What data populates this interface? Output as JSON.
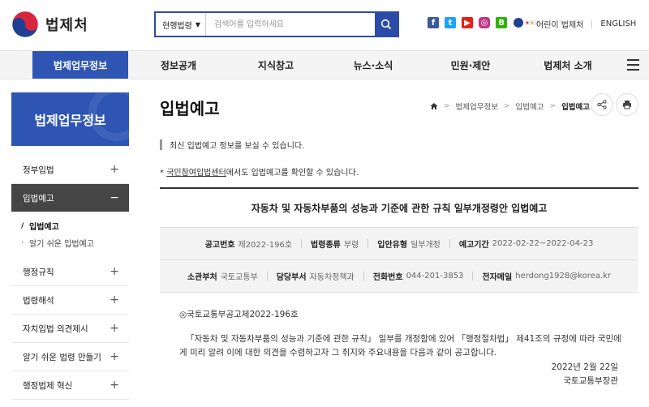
{
  "header": {
    "logo_text": "법제처",
    "search": {
      "scope": "현행법령",
      "placeholder": "검색어를 입력하세요"
    },
    "sns": [
      {
        "name": "facebook-icon",
        "glyph": "f",
        "color": "#3b5998"
      },
      {
        "name": "twitter-icon",
        "glyph": "t",
        "color": "#1da1f2"
      },
      {
        "name": "youtube-icon",
        "glyph": "▶",
        "color": "#e62117"
      },
      {
        "name": "instagram-icon",
        "glyph": "◎",
        "color": "#c13584"
      },
      {
        "name": "blog-icon",
        "glyph": "B",
        "color": "#2db400"
      }
    ],
    "links": [
      "어린이 법제처",
      "ENGLISH"
    ]
  },
  "gnb": {
    "items": [
      "법제업무정보",
      "정보공개",
      "지식창고",
      "뉴스·소식",
      "민원·제안",
      "법제처 소개"
    ]
  },
  "sidebar": {
    "title": "법제업무정보",
    "items": [
      {
        "label": "정부입법",
        "toggle": "+"
      },
      {
        "label": "입법예고",
        "toggle": "−"
      },
      {
        "label": "행정규칙",
        "toggle": "+"
      },
      {
        "label": "법령해석",
        "toggle": "+"
      },
      {
        "label": "자치입법 의견제시",
        "toggle": "+"
      },
      {
        "label": "알기 쉬운 법령 만들기",
        "toggle": "+"
      },
      {
        "label": "행정법제 혁신",
        "toggle": "+"
      }
    ],
    "sub_items": [
      {
        "label": "입법예고",
        "bullet": "/"
      },
      {
        "label": "알기 쉬운 입법예고",
        "bullet": "·"
      }
    ]
  },
  "content": {
    "title": "입법예고",
    "breadcrumb": [
      "법제업무정보",
      "입법예고",
      "입법예고"
    ],
    "intro": "최신 입법예고 정보를 보실 수 있습니다.",
    "notice_prefix": "* ",
    "notice_link": "국민참여입법센터",
    "notice_suffix": "에서도 입법예고를 확인할 수 있습니다.",
    "board": {
      "title": "자동차 및 자동차부품의 성능과 기준에 관한 규칙 일부개정령안 입법예고",
      "row1": [
        {
          "k": "공고번호",
          "v": "제2022-196호"
        },
        {
          "k": "법령종류",
          "v": "부령"
        },
        {
          "k": "입안유형",
          "v": "일부개정"
        },
        {
          "k": "예고기간",
          "v": "2022-02-22~2022-04-23"
        }
      ],
      "row2": [
        {
          "k": "소관부처",
          "v": "국토교통부"
        },
        {
          "k": "담당부서",
          "v": "자동차정책과"
        },
        {
          "k": "전화번호",
          "v": "044-201-3853"
        },
        {
          "k": "전자메일",
          "v": "herdong1928@korea.kr"
        }
      ]
    },
    "body": {
      "notice_no": "◎국토교통부공고제2022-196호",
      "paragraph": "「자동차 및 자동차부품의 성능과 기준에 관한 규칙」 일부를 개정함에 있어 「행정절차법」 제41조의 규정에 따라 국민에게 미리 알려 이에 대한 의견을 수렴하고자 그 취지와 주요내용을 다음과 같이 공고합니다.",
      "date": "2022년 2월 22일",
      "signer": "국토교통부장관"
    }
  },
  "colors": {
    "brand_blue": "#2e55b3",
    "search_blue": "#2b4ba8"
  }
}
